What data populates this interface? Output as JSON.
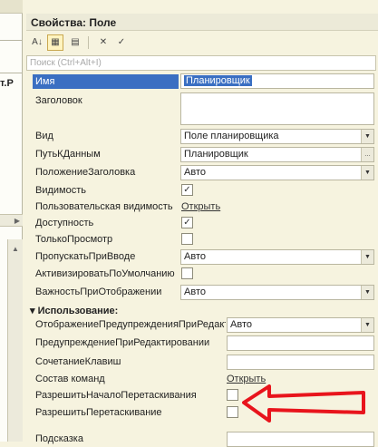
{
  "left_panel": {
    "fragment_text": "т.Р"
  },
  "panel": {
    "title": "Свойства: Поле",
    "toolbar": {
      "icons": [
        "sort-alpha-icon",
        "categorized-icon",
        "filter-icon",
        "delete-icon",
        "apply-icon"
      ],
      "glyphs": [
        "A↓",
        "▦",
        "▤",
        "✕",
        "✓"
      ]
    },
    "search": {
      "placeholder": "Поиск (Ctrl+Alt+I)"
    },
    "properties": [
      {
        "label": "Имя",
        "value": "Планировщик",
        "kind": "text-selected"
      },
      {
        "label": "Заголовок",
        "value": "",
        "kind": "textarea"
      },
      {
        "label": "Вид",
        "value": "Поле планировщика",
        "kind": "dropdown"
      },
      {
        "label": "ПутьКДанным",
        "value": "Планировщик",
        "kind": "ellipsis"
      },
      {
        "label": "ПоложениеЗаголовка",
        "value": "Авто",
        "kind": "dropdown"
      },
      {
        "label": "Видимость",
        "checked": true,
        "kind": "checkbox"
      },
      {
        "label": "Пользовательская видимость",
        "value": "Открыть",
        "kind": "link"
      },
      {
        "label": "Доступность",
        "checked": true,
        "kind": "checkbox"
      },
      {
        "label": "ТолькоПросмотр",
        "checked": false,
        "kind": "checkbox"
      },
      {
        "label": "ПропускатьПриВводе",
        "value": "Авто",
        "kind": "dropdown"
      },
      {
        "label": "АктивизироватьПоУмолчанию",
        "checked": false,
        "kind": "checkbox"
      },
      {
        "label": "ВажностьПриОтображении",
        "value": "Авто",
        "kind": "dropdown"
      }
    ],
    "usage_section": {
      "title": "Использование:",
      "properties": [
        {
          "label": "ОтображениеПредупрежденияПриРедакт",
          "value": "Авто",
          "kind": "dropdown"
        },
        {
          "label": "ПредупреждениеПриРедактировании",
          "value": "",
          "kind": "text"
        },
        {
          "label": "СочетаниеКлавиш",
          "value": "",
          "kind": "text"
        },
        {
          "label": "Состав команд",
          "value": "Открыть",
          "kind": "link"
        },
        {
          "label": "РазрешитьНачалоПеретаскивания",
          "checked": false,
          "kind": "checkbox"
        },
        {
          "label": "РазрешитьПеретаскивание",
          "checked": false,
          "kind": "checkbox"
        },
        {
          "label": "Подсказка",
          "value": "",
          "kind": "text"
        }
      ]
    },
    "annotation": {
      "color": "#e8141c"
    },
    "colors": {
      "selection": "#3a6fc2",
      "panel_bg": "#f6f3df"
    }
  }
}
